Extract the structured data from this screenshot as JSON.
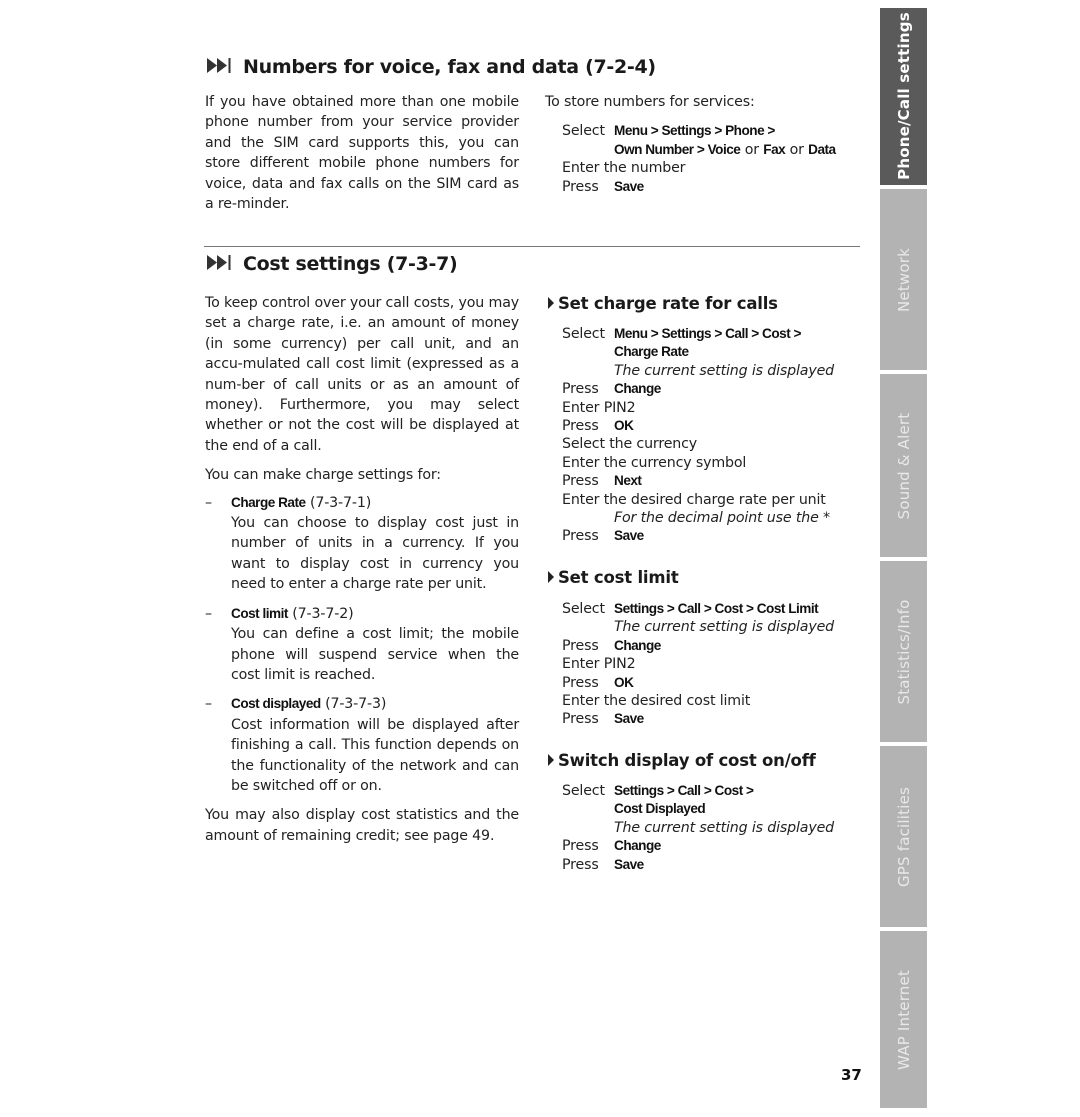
{
  "page_number": "37",
  "colors": {
    "active_tab": "#5a5a5a",
    "inactive_tab": "#b3b3b3",
    "rule": "#777777",
    "text": "#222222"
  },
  "side_tabs": [
    {
      "label": "Phone/Call settings",
      "active": true
    },
    {
      "label": "Network",
      "active": false
    },
    {
      "label": "Sound & Alert",
      "active": false
    },
    {
      "label": "Statistics/Info",
      "active": false
    },
    {
      "label": "GPS facilities",
      "active": false
    },
    {
      "label": "WAP Internet",
      "active": false
    }
  ],
  "section1": {
    "icon": "fast-forward-end-icon",
    "title": "Numbers for voice, fax and data (7-2-4)",
    "body": "If you have obtained more than one mobile phone number from your service provider and the SIM card supports this, you can store different mobile phone numbers for voice, data and fax calls on the SIM card as a re-minder.",
    "intro": "To store numbers for services:",
    "steps": {
      "select_label": "Select",
      "path_line1": "Menu > Settings > Phone >",
      "path_line2_a": "Own Number > Voice",
      "or1": " or ",
      "path_line2_b": "Fax",
      "or2": " or ",
      "path_line2_c": "Data",
      "enter_number": "Enter the number",
      "press_label": "Press",
      "save": "Save"
    }
  },
  "section2": {
    "icon": "fast-forward-end-icon",
    "title": "Cost settings (7-3-7)",
    "intro": "To keep control over your call costs, you may set a charge rate, i.e. an amount of money (in some currency) per call unit, and an accu-mulated call cost limit (expressed as a num-ber of call units or as an amount of money). Furthermore, you may select whether or not the cost will be displayed at the end of a call.",
    "can_make": "You can make charge settings for:",
    "items": [
      {
        "dash": "–",
        "term": "Charge Rate",
        "code": " (7-3-7-1)",
        "desc": "You can choose to display cost just in number of units in a currency. If you want to display cost in currency you need to enter a charge rate per unit."
      },
      {
        "dash": "–",
        "term": "Cost limit",
        "code": " (7-3-7-2)",
        "desc": "You can define a cost limit; the mobile phone will suspend service when the cost limit is reached."
      },
      {
        "dash": "–",
        "term": "Cost displayed",
        "code": " (7-3-7-3)",
        "desc": "Cost information will be displayed after finishing a call. This function depends on the functionality of the network and can be switched off or on."
      }
    ],
    "outro": "You may also display cost statistics and the amount of remaining credit; see page 49.",
    "sub1": {
      "title": "Set charge rate for calls",
      "select": "Select",
      "path1": "Menu > Settings > Call > Cost >",
      "path2": "Charge Rate",
      "note1": "The current setting is displayed",
      "press": "Press",
      "change": "Change",
      "enter_pin": "Enter PIN2",
      "ok": "OK",
      "select_currency": "Select the currency",
      "enter_symbol": "Enter the currency symbol",
      "next": "Next",
      "enter_rate": "Enter the desired charge rate per unit",
      "note2": "For the decimal point use the *",
      "save": "Save"
    },
    "sub2": {
      "title": "Set cost limit",
      "select": "Select",
      "path1": "Settings > Call > Cost > Cost Limit",
      "note1": "The current setting is displayed",
      "press": "Press",
      "change": "Change",
      "enter_pin": "Enter PIN2",
      "ok": "OK",
      "enter_limit": "Enter the desired cost limit",
      "save": "Save"
    },
    "sub3": {
      "title": "Switch display of cost on/off",
      "select": "Select",
      "path1": "Settings > Call > Cost >",
      "path2": "Cost Displayed",
      "note1": "The current setting is displayed",
      "press": "Press",
      "change": "Change",
      "save": "Save"
    }
  }
}
